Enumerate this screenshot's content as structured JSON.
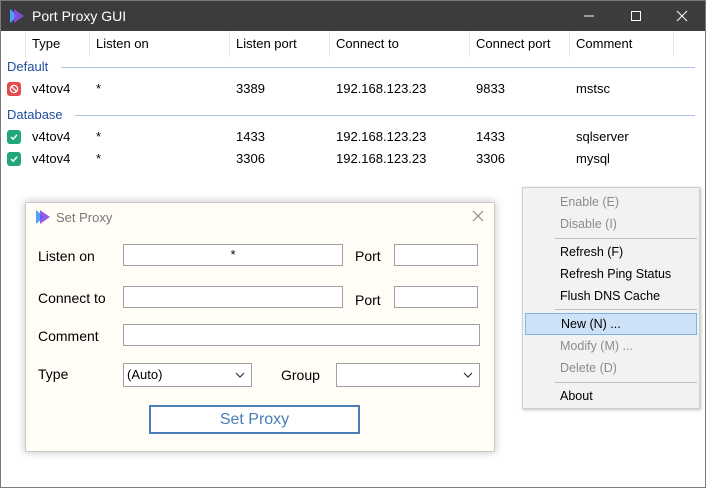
{
  "window": {
    "title": "Port Proxy GUI"
  },
  "columns": [
    "Type",
    "Listen on",
    "Listen port",
    "Connect to",
    "Connect port",
    "Comment"
  ],
  "groups": [
    {
      "name": "Default",
      "rows": [
        {
          "status": "error",
          "type": "v4tov4",
          "listen_on": "*",
          "listen_port": "3389",
          "connect_to": "192.168.123.23",
          "connect_port": "9833",
          "comment": "mstsc"
        }
      ]
    },
    {
      "name": "Database",
      "rows": [
        {
          "status": "ok",
          "type": "v4tov4",
          "listen_on": "*",
          "listen_port": "1433",
          "connect_to": "192.168.123.23",
          "connect_port": "1433",
          "comment": "sqlserver"
        },
        {
          "status": "ok",
          "type": "v4tov4",
          "listen_on": "*",
          "listen_port": "3306",
          "connect_to": "192.168.123.23",
          "connect_port": "3306",
          "comment": "mysql"
        }
      ]
    }
  ],
  "dialog": {
    "title": "Set Proxy",
    "listen_on_label": "Listen on",
    "listen_on_value": "*",
    "port_label": "Port",
    "listen_port_value": "",
    "connect_to_label": "Connect to",
    "connect_to_value": "",
    "connect_port_label": "Port",
    "connect_port_value": "",
    "comment_label": "Comment",
    "comment_value": "",
    "type_label": "Type",
    "type_value": "(Auto)",
    "group_label": "Group",
    "group_value": "",
    "submit_label": "Set Proxy"
  },
  "context_menu": {
    "items": [
      {
        "label": "Enable (E)",
        "disabled": true
      },
      {
        "label": "Disable (I)",
        "disabled": true
      },
      {
        "label": "Refresh (F)",
        "disabled": false
      },
      {
        "label": "Refresh Ping Status",
        "disabled": false
      },
      {
        "label": "Flush DNS Cache",
        "disabled": false
      },
      {
        "label": "New (N) ...",
        "disabled": false,
        "highlighted": true
      },
      {
        "label": "Modify (M) ...",
        "disabled": true
      },
      {
        "label": "Delete (D)",
        "disabled": true
      },
      {
        "label": "About",
        "disabled": false
      }
    ]
  },
  "colors": {
    "titlebar": "#3c3c3c",
    "group_text": "#1f4e9e",
    "error": "#e44b4b",
    "ok": "#22a779",
    "accent": "#4a7cb8"
  },
  "icons": {
    "app": "port-proxy-logo-icon",
    "error": "error-status-icon",
    "ok": "checkmark-status-icon"
  }
}
